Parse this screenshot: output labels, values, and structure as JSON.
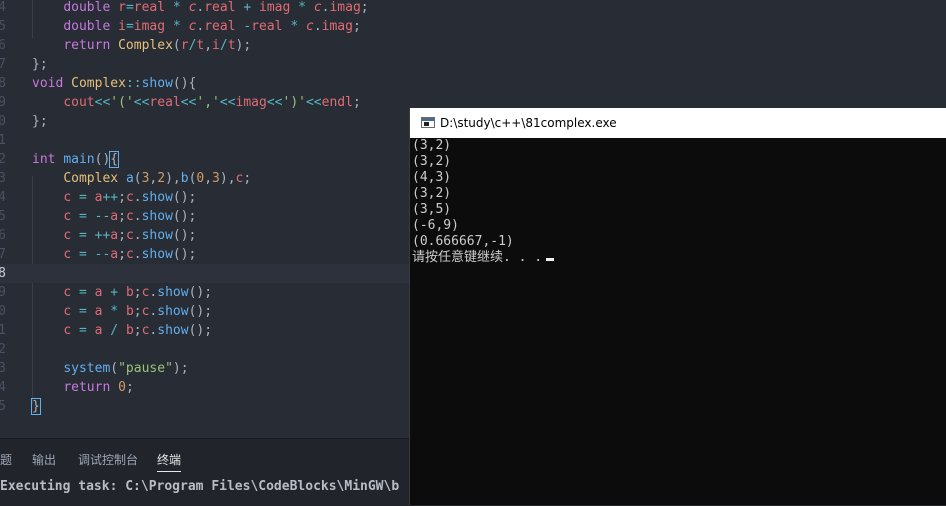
{
  "editor": {
    "lines": [
      {
        "num": "4",
        "tokens": [
          {
            "t": "    "
          },
          {
            "t": "double",
            "c": "kw"
          },
          {
            "t": " "
          },
          {
            "t": "r",
            "c": "vr"
          },
          {
            "t": "=",
            "c": "op"
          },
          {
            "t": "real",
            "c": "vr"
          },
          {
            "t": " "
          },
          {
            "t": "*",
            "c": "op"
          },
          {
            "t": " "
          },
          {
            "t": "c",
            "c": "vi"
          },
          {
            "t": ".",
            "c": "pn"
          },
          {
            "t": "real",
            "c": "vr"
          },
          {
            "t": " "
          },
          {
            "t": "+",
            "c": "op"
          },
          {
            "t": " "
          },
          {
            "t": "imag",
            "c": "vr"
          },
          {
            "t": " "
          },
          {
            "t": "*",
            "c": "op"
          },
          {
            "t": " "
          },
          {
            "t": "c",
            "c": "vi"
          },
          {
            "t": ".",
            "c": "pn"
          },
          {
            "t": "imag",
            "c": "vr"
          },
          {
            "t": ";",
            "c": "pn"
          }
        ]
      },
      {
        "num": "5",
        "tokens": [
          {
            "t": "    "
          },
          {
            "t": "double",
            "c": "kw"
          },
          {
            "t": " "
          },
          {
            "t": "i",
            "c": "vr"
          },
          {
            "t": "=",
            "c": "op"
          },
          {
            "t": "imag",
            "c": "vr"
          },
          {
            "t": " "
          },
          {
            "t": "*",
            "c": "op"
          },
          {
            "t": " "
          },
          {
            "t": "c",
            "c": "vi"
          },
          {
            "t": ".",
            "c": "pn"
          },
          {
            "t": "real",
            "c": "vr"
          },
          {
            "t": " "
          },
          {
            "t": "-",
            "c": "op"
          },
          {
            "t": "real",
            "c": "vr"
          },
          {
            "t": " "
          },
          {
            "t": "*",
            "c": "op"
          },
          {
            "t": " "
          },
          {
            "t": "c",
            "c": "vi"
          },
          {
            "t": ".",
            "c": "pn"
          },
          {
            "t": "imag",
            "c": "vr"
          },
          {
            "t": ";",
            "c": "pn"
          }
        ]
      },
      {
        "num": "6",
        "tokens": [
          {
            "t": "    "
          },
          {
            "t": "return",
            "c": "kw"
          },
          {
            "t": " "
          },
          {
            "t": "Complex",
            "c": "ty"
          },
          {
            "t": "(",
            "c": "pn"
          },
          {
            "t": "r",
            "c": "vr"
          },
          {
            "t": "/",
            "c": "op"
          },
          {
            "t": "t",
            "c": "vr"
          },
          {
            "t": ",",
            "c": "pn"
          },
          {
            "t": "i",
            "c": "vr"
          },
          {
            "t": "/",
            "c": "op"
          },
          {
            "t": "t",
            "c": "vr"
          },
          {
            "t": ");",
            "c": "pn"
          }
        ]
      },
      {
        "num": "7",
        "tokens": [
          {
            "t": "};",
            "c": "pn"
          }
        ]
      },
      {
        "num": "8",
        "tokens": [
          {
            "t": "void",
            "c": "kw"
          },
          {
            "t": " "
          },
          {
            "t": "Complex",
            "c": "cls"
          },
          {
            "t": "::",
            "c": "op"
          },
          {
            "t": "show",
            "c": "fn"
          },
          {
            "t": "(){",
            "c": "pn"
          }
        ]
      },
      {
        "num": "9",
        "tokens": [
          {
            "t": "    "
          },
          {
            "t": "cout",
            "c": "vr"
          },
          {
            "t": "<<",
            "c": "op"
          },
          {
            "t": "'('",
            "c": "st"
          },
          {
            "t": "<<",
            "c": "op"
          },
          {
            "t": "real",
            "c": "vr"
          },
          {
            "t": "<<",
            "c": "op"
          },
          {
            "t": "','",
            "c": "st"
          },
          {
            "t": "<<",
            "c": "op"
          },
          {
            "t": "imag",
            "c": "vr"
          },
          {
            "t": "<<",
            "c": "op"
          },
          {
            "t": "')'",
            "c": "st"
          },
          {
            "t": "<<",
            "c": "op"
          },
          {
            "t": "endl",
            "c": "vr"
          },
          {
            "t": ";",
            "c": "pn"
          }
        ]
      },
      {
        "num": "0",
        "tokens": [
          {
            "t": "};",
            "c": "pn"
          }
        ]
      },
      {
        "num": "1",
        "tokens": []
      },
      {
        "num": "2",
        "tokens": [
          {
            "t": "int",
            "c": "kw"
          },
          {
            "t": " "
          },
          {
            "t": "main",
            "c": "fn"
          },
          {
            "t": "()",
            "c": "pn"
          },
          {
            "t": "{",
            "c": "pn",
            "m": true
          }
        ]
      },
      {
        "num": "3",
        "tokens": [
          {
            "t": "    "
          },
          {
            "t": "Complex",
            "c": "ty"
          },
          {
            "t": " "
          },
          {
            "t": "a",
            "c": "fn"
          },
          {
            "t": "(",
            "c": "pn"
          },
          {
            "t": "3",
            "c": "nm"
          },
          {
            "t": ",",
            "c": "pn"
          },
          {
            "t": "2",
            "c": "nm"
          },
          {
            "t": "),",
            "c": "pn"
          },
          {
            "t": "b",
            "c": "fn"
          },
          {
            "t": "(",
            "c": "pn"
          },
          {
            "t": "0",
            "c": "nm"
          },
          {
            "t": ",",
            "c": "pn"
          },
          {
            "t": "3",
            "c": "nm"
          },
          {
            "t": "),",
            "c": "pn"
          },
          {
            "t": "c",
            "c": "vr"
          },
          {
            "t": ";",
            "c": "pn"
          }
        ]
      },
      {
        "num": "4",
        "tokens": [
          {
            "t": "    "
          },
          {
            "t": "c",
            "c": "vr"
          },
          {
            "t": " "
          },
          {
            "t": "=",
            "c": "op"
          },
          {
            "t": " "
          },
          {
            "t": "a",
            "c": "vr"
          },
          {
            "t": "++",
            "c": "op"
          },
          {
            "t": ";",
            "c": "pn"
          },
          {
            "t": "c",
            "c": "vr"
          },
          {
            "t": ".",
            "c": "pn"
          },
          {
            "t": "show",
            "c": "fn"
          },
          {
            "t": "();",
            "c": "pn"
          }
        ]
      },
      {
        "num": "5",
        "tokens": [
          {
            "t": "    "
          },
          {
            "t": "c",
            "c": "vr"
          },
          {
            "t": " "
          },
          {
            "t": "=",
            "c": "op"
          },
          {
            "t": " "
          },
          {
            "t": "--",
            "c": "op"
          },
          {
            "t": "a",
            "c": "vr"
          },
          {
            "t": ";",
            "c": "pn"
          },
          {
            "t": "c",
            "c": "vr"
          },
          {
            "t": ".",
            "c": "pn"
          },
          {
            "t": "show",
            "c": "fn"
          },
          {
            "t": "();",
            "c": "pn"
          }
        ]
      },
      {
        "num": "6",
        "tokens": [
          {
            "t": "    "
          },
          {
            "t": "c",
            "c": "vr"
          },
          {
            "t": " "
          },
          {
            "t": "=",
            "c": "op"
          },
          {
            "t": " "
          },
          {
            "t": "++",
            "c": "op"
          },
          {
            "t": "a",
            "c": "vr"
          },
          {
            "t": ";",
            "c": "pn"
          },
          {
            "t": "c",
            "c": "vr"
          },
          {
            "t": ".",
            "c": "pn"
          },
          {
            "t": "show",
            "c": "fn"
          },
          {
            "t": "();",
            "c": "pn"
          }
        ]
      },
      {
        "num": "7",
        "tokens": [
          {
            "t": "    "
          },
          {
            "t": "c",
            "c": "vr"
          },
          {
            "t": " "
          },
          {
            "t": "=",
            "c": "op"
          },
          {
            "t": " "
          },
          {
            "t": "--",
            "c": "op"
          },
          {
            "t": "a",
            "c": "vr"
          },
          {
            "t": ";",
            "c": "pn"
          },
          {
            "t": "c",
            "c": "vr"
          },
          {
            "t": ".",
            "c": "pn"
          },
          {
            "t": "show",
            "c": "fn"
          },
          {
            "t": "();",
            "c": "pn"
          }
        ]
      },
      {
        "num": "8",
        "current": true,
        "tokens": []
      },
      {
        "num": "9",
        "tokens": [
          {
            "t": "    "
          },
          {
            "t": "c",
            "c": "vr"
          },
          {
            "t": " "
          },
          {
            "t": "=",
            "c": "op"
          },
          {
            "t": " "
          },
          {
            "t": "a",
            "c": "vr"
          },
          {
            "t": " "
          },
          {
            "t": "+",
            "c": "op"
          },
          {
            "t": " "
          },
          {
            "t": "b",
            "c": "vr"
          },
          {
            "t": ";",
            "c": "pn"
          },
          {
            "t": "c",
            "c": "vr"
          },
          {
            "t": ".",
            "c": "pn"
          },
          {
            "t": "show",
            "c": "fn"
          },
          {
            "t": "();",
            "c": "pn"
          }
        ]
      },
      {
        "num": "0",
        "tokens": [
          {
            "t": "    "
          },
          {
            "t": "c",
            "c": "vr"
          },
          {
            "t": " "
          },
          {
            "t": "=",
            "c": "op"
          },
          {
            "t": " "
          },
          {
            "t": "a",
            "c": "vr"
          },
          {
            "t": " "
          },
          {
            "t": "*",
            "c": "op"
          },
          {
            "t": " "
          },
          {
            "t": "b",
            "c": "vr"
          },
          {
            "t": ";",
            "c": "pn"
          },
          {
            "t": "c",
            "c": "vr"
          },
          {
            "t": ".",
            "c": "pn"
          },
          {
            "t": "show",
            "c": "fn"
          },
          {
            "t": "();",
            "c": "pn"
          }
        ]
      },
      {
        "num": "1",
        "tokens": [
          {
            "t": "    "
          },
          {
            "t": "c",
            "c": "vr"
          },
          {
            "t": " "
          },
          {
            "t": "=",
            "c": "op"
          },
          {
            "t": " "
          },
          {
            "t": "a",
            "c": "vr"
          },
          {
            "t": " "
          },
          {
            "t": "/",
            "c": "op"
          },
          {
            "t": " "
          },
          {
            "t": "b",
            "c": "vr"
          },
          {
            "t": ";",
            "c": "pn"
          },
          {
            "t": "c",
            "c": "vr"
          },
          {
            "t": ".",
            "c": "pn"
          },
          {
            "t": "show",
            "c": "fn"
          },
          {
            "t": "();",
            "c": "pn"
          }
        ]
      },
      {
        "num": "2",
        "tokens": []
      },
      {
        "num": "3",
        "tokens": [
          {
            "t": "    "
          },
          {
            "t": "system",
            "c": "fn"
          },
          {
            "t": "(",
            "c": "pn"
          },
          {
            "t": "\"pause\"",
            "c": "st"
          },
          {
            "t": ");",
            "c": "pn"
          }
        ]
      },
      {
        "num": "4",
        "tokens": [
          {
            "t": "    "
          },
          {
            "t": "return",
            "c": "kw"
          },
          {
            "t": " "
          },
          {
            "t": "0",
            "c": "nm"
          },
          {
            "t": ";",
            "c": "pn"
          }
        ]
      },
      {
        "num": "5",
        "tokens": [
          {
            "t": "}",
            "c": "pn",
            "m": true
          }
        ]
      }
    ]
  },
  "panel": {
    "tabs": [
      {
        "label": "题",
        "active": false
      },
      {
        "label": "输出",
        "active": false
      },
      {
        "label": "调试控制台",
        "active": false
      },
      {
        "label": "终端",
        "active": true
      }
    ],
    "task_text": "Executing task: C:\\Program Files\\CodeBlocks\\MinGW\\b"
  },
  "console": {
    "title": "D:\\study\\c++\\81complex.exe",
    "lines": [
      "(3,2)",
      "(3,2)",
      "(4,3)",
      "(3,2)",
      "(3,5)",
      "(-6,9)",
      "(0.666667,-1)",
      "请按任意键继续. . ."
    ]
  },
  "colors": {
    "editor_bg": "#282c34",
    "panel_bg": "#21252b",
    "console_bg": "#0c0c0c",
    "console_text": "#cccccc"
  }
}
